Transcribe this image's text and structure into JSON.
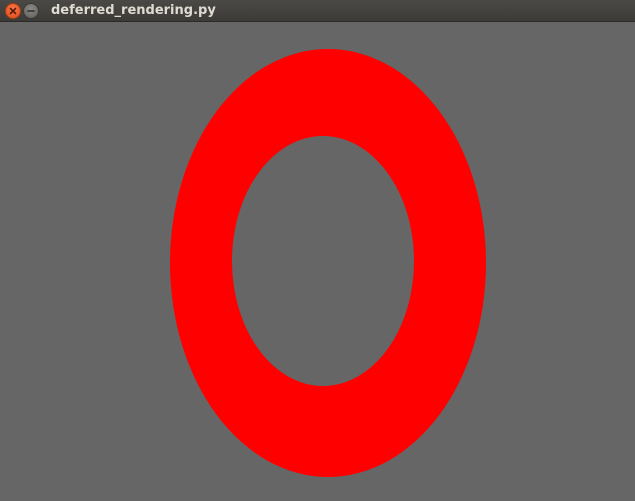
{
  "window": {
    "title": "deferred_rendering.py"
  },
  "canvas": {
    "background_color": "#666666",
    "shape": "ring",
    "shape_color": "#ff0000"
  },
  "icons": {
    "close": "close-icon",
    "minimize": "minimize-icon"
  }
}
